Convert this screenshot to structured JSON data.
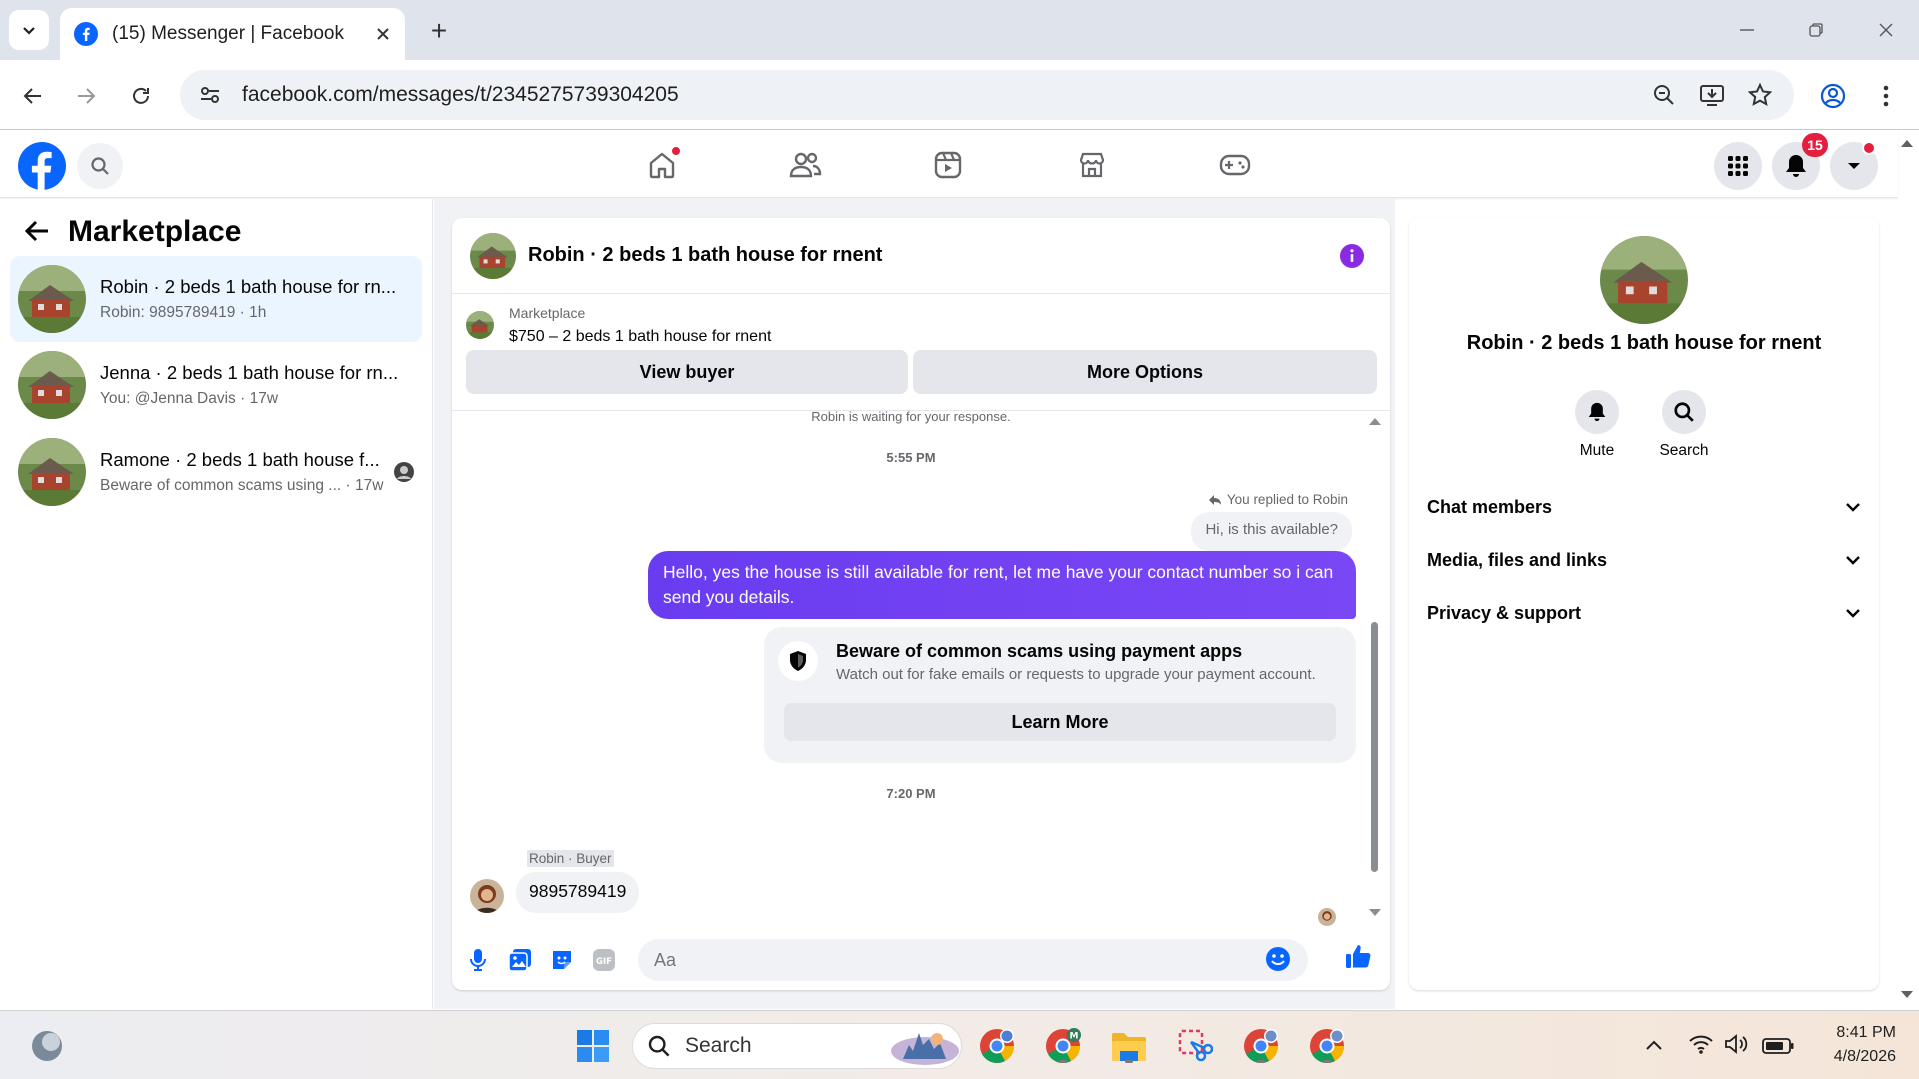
{
  "browser": {
    "tab_title": "(15) Messenger | Facebook",
    "new_tab": "+",
    "url": "facebook.com/messages/t/2345275739304205"
  },
  "fb": {
    "notification_count": "15",
    "colors": {
      "brand": "#0866ff",
      "bubble": "#6e3ff3",
      "badge": "#e41e3f"
    }
  },
  "left": {
    "title": "Marketplace",
    "conversations": [
      {
        "name": "Robin · 2 beds 1 bath house for rn...",
        "sub": "Robin: 9895789419 · 1h"
      },
      {
        "name": "Jenna · 2 beds 1 bath house for rn...",
        "sub": "You: @Jenna Davis · 17w"
      },
      {
        "name": "Ramone · 2 beds 1 bath house f...",
        "sub": "Beware of common scams using ... · 17w"
      }
    ]
  },
  "chat": {
    "title": "Robin · 2 beds 1 bath house for rnent",
    "listing_label": "Marketplace",
    "listing_price": "$750 – 2 beds 1 bath house for rnent",
    "view_buyer": "View buyer",
    "more_options": "More Options",
    "cut_line": "Robin is waiting for your response.",
    "time1": "5:55 PM",
    "replied_note": "You replied to Robin",
    "quoted": "Hi, is this available?",
    "my_message": "Hello, yes the house is still available for rent, let me have your contact number so i can send you details.",
    "scam_title": "Beware of common scams using payment apps",
    "scam_desc": "Watch out for fake emails or requests to upgrade your payment account.",
    "learn_more": "Learn More",
    "time2": "7:20 PM",
    "sender_label": "Robin · Buyer",
    "their_message": "9895789419",
    "input_placeholder": "Aa"
  },
  "right": {
    "name": "Robin · 2 beds 1 bath house for rnent",
    "mute": "Mute",
    "search": "Search",
    "rows": [
      "Chat members",
      "Media, files and links",
      "Privacy & support"
    ]
  },
  "taskbar": {
    "search": "Search",
    "time": "8:41 PM",
    "date": "4/8/2026"
  }
}
